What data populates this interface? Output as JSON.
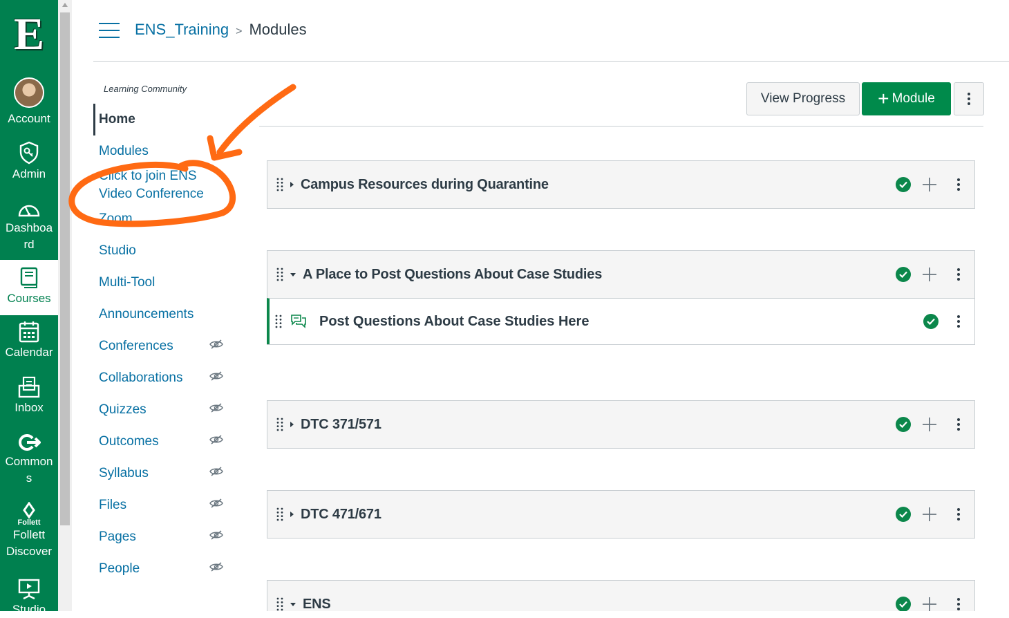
{
  "global_nav": {
    "logo_letter": "E",
    "items": [
      {
        "label": "Account",
        "icon": "avatar"
      },
      {
        "label": "Admin",
        "icon": "shield-key-icon"
      },
      {
        "label": "Dashboa rd",
        "icon": "dashboard-gauge-icon"
      },
      {
        "label": "Courses",
        "icon": "book-icon"
      },
      {
        "label": "Calendar",
        "icon": "calendar-icon"
      },
      {
        "label": "Inbox",
        "icon": "inbox-icon"
      },
      {
        "label": "Common s",
        "icon": "commons-arrow-icon"
      },
      {
        "label": "Follett Discover",
        "icon": "follett-icon",
        "icon_text": "Follett"
      },
      {
        "label": "Studio",
        "icon": "studio-icon"
      }
    ],
    "brand_color": "#00804f"
  },
  "header": {
    "course": "ENS_Training",
    "separator": ">",
    "page": "Modules"
  },
  "course_nav": {
    "subtitle": "Learning Community",
    "items": [
      {
        "label": "Home",
        "active": true,
        "hidden": false
      },
      {
        "label": "Modules",
        "active": false,
        "hidden": false
      },
      {
        "label_line1": "Click to join ENS",
        "label_line2": "Video Conference",
        "active": false,
        "hidden": false
      },
      {
        "label": "Zoom",
        "active": false,
        "hidden": false
      },
      {
        "label": "Studio",
        "active": false,
        "hidden": false
      },
      {
        "label": "Multi-Tool",
        "active": false,
        "hidden": false
      },
      {
        "label": "Announcements",
        "active": false,
        "hidden": false
      },
      {
        "label": "Conferences",
        "active": false,
        "hidden": true
      },
      {
        "label": "Collaborations",
        "active": false,
        "hidden": true
      },
      {
        "label": "Quizzes",
        "active": false,
        "hidden": true
      },
      {
        "label": "Outcomes",
        "active": false,
        "hidden": true
      },
      {
        "label": "Syllabus",
        "active": false,
        "hidden": true
      },
      {
        "label": "Files",
        "active": false,
        "hidden": true
      },
      {
        "label": "Pages",
        "active": false,
        "hidden": true
      },
      {
        "label": "People",
        "active": false,
        "hidden": true
      }
    ]
  },
  "toolbar": {
    "view_progress": "View Progress",
    "add_module": "Module",
    "add_module_symbol": "+"
  },
  "modules": [
    {
      "title": "Campus Resources during Quarantine",
      "expanded": false,
      "published": true,
      "items": []
    },
    {
      "title": "A Place to Post Questions About Case Studies",
      "expanded": true,
      "published": true,
      "items": [
        {
          "title": "Post Questions About Case Studies Here",
          "icon": "discussion-icon",
          "published": true
        }
      ]
    },
    {
      "title": "DTC 371/571",
      "expanded": false,
      "published": true,
      "items": []
    },
    {
      "title": "DTC 471/671",
      "expanded": false,
      "published": true,
      "items": []
    },
    {
      "title": "ENS",
      "expanded": true,
      "published": true,
      "items": []
    }
  ],
  "annotation": {
    "color": "#ff6a13",
    "shape": "hand-drawn circle and arrow"
  }
}
